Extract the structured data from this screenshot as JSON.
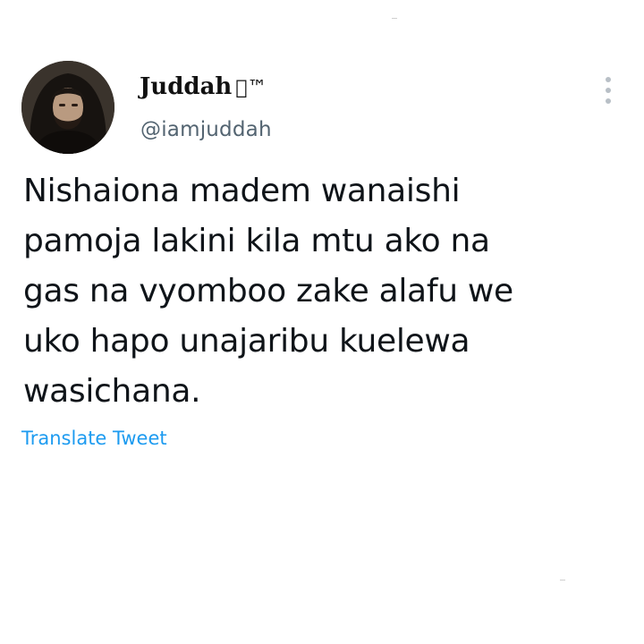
{
  "tweet": {
    "author": {
      "display_name": "Juddah",
      "name_badge": "™",
      "handle": "@iamjuddah"
    },
    "text_lines": [
      "Nishaiona madem wanaishi",
      "pamoja lakini kila mtu ako na",
      "gas na vyomboo zake alafu we",
      "uko hapo unajaribu kuelewa",
      "wasichana."
    ],
    "translate_label": "Translate Tweet"
  },
  "colors": {
    "background": "#ffffff",
    "text": "#0f1419",
    "secondary": "#536471",
    "link": "#1d9bf0"
  },
  "icons": {
    "more": "more-vertical-icon",
    "avatar": "profile-photo"
  }
}
